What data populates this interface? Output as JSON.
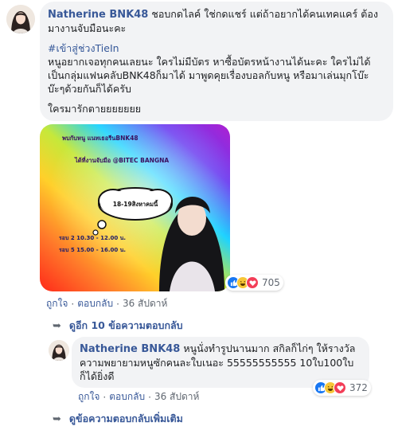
{
  "comment": {
    "author": "Natherine BNK48",
    "line1": "ชอบกดไลค์ ใช่กดแชร์ แต่ถ้าอยากได้คนเทคแคร์ ต้องมางานจับมือนะคะ",
    "hashtag": "#เข้าสู่ช่วงTieIn",
    "body": "หนูอยากเจอทุกคนเลยนะ ใครไม่มีบัตร หาซื้อบัตรหน้างานได้นะคะ ใครไม่ได้เป็นกลุ่มแฟนคลับBNK48ก็มาได้ มาพูดคุยเรื่องบอลกับหนู หรือมาเล่นมุกโบ๊ะบ๊ะๆด้วยกันก็ได้ครับ",
    "closing": "ใครมารักตายยยยยยย",
    "reaction_count": "705",
    "actions": {
      "like": "ถูกใจ",
      "reply": "ตอบกลับ",
      "time": "36 สัปดาห์"
    }
  },
  "photo": {
    "line1": "พบกับหนู แนทเธอรีนBNK48",
    "line2": "ได้ที่งานจับมือ @BITEC BANGNA",
    "cloud": "18-19สิงหาคมนี้",
    "round1": "รอบ 2 10.30 - 12.00 น.",
    "round2": "รอบ 5 15.00 - 16.00 น."
  },
  "view_replies": "ดูอีก 10 ข้อความตอบกลับ",
  "reply": {
    "author": "Natherine BNK48",
    "text": "หนูนั่งทำรูปนานมาก สกิลก็ไก่ๆ ให้รางวัลความพยายามหนูซักคนละใบเนอะ 55555555555 10ใบ100ใบก็ได้ยิ่งดี",
    "reaction_count": "372",
    "actions": {
      "like": "ถูกใจ",
      "reply": "ตอบกลับ",
      "time": "36 สัปดาห์"
    }
  },
  "view_more": "ดูข้อความตอบกลับเพิ่มเติม",
  "colors": {
    "link": "#385898",
    "bubble": "#f2f3f5",
    "meta": "#606770"
  }
}
